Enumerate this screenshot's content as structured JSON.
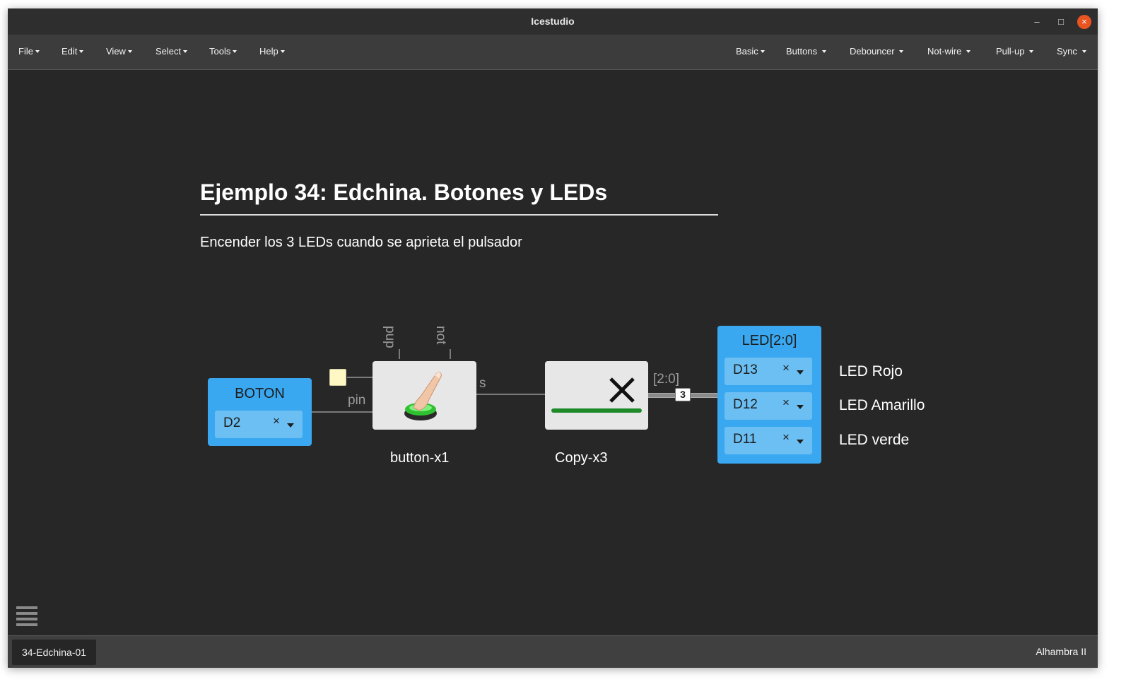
{
  "window": {
    "title": "Icestudio"
  },
  "titlebar_controls": {
    "minimize": "–",
    "maximize": "□",
    "close": "×"
  },
  "menu_left": [
    "File",
    "Edit",
    "View",
    "Select",
    "Tools",
    "Help"
  ],
  "menu_right": [
    "Basic",
    "Buttons",
    "Debouncer",
    "Not-wire",
    "Pull-up",
    "Sync"
  ],
  "canvas": {
    "heading": "Ejemplo 34: Edchina. Botones y LEDs",
    "description": "Encender los 3 LEDs cuando se aprieta el pulsador",
    "input_block": {
      "title": "BOTON",
      "pin": "D2",
      "clear": "×"
    },
    "button_block": {
      "name": "button-x1",
      "port_in": "pin",
      "port_out": "s",
      "param_pup": "pup",
      "param_not": "not"
    },
    "copy_block": {
      "name": "Copy-x3",
      "bus_label": "[2:0]",
      "bus_width": "3"
    },
    "output_block": {
      "title": "LED[2:0]",
      "pins": [
        {
          "value": "D13",
          "clear": "×"
        },
        {
          "value": "D12",
          "clear": "×"
        },
        {
          "value": "D11",
          "clear": "×"
        }
      ]
    },
    "led_labels": [
      "LED Rojo",
      "LED Amarillo",
      "LED verde"
    ]
  },
  "statusbar": {
    "file": "34-Edchina-01",
    "board": "Alhambra II"
  },
  "colors": {
    "io_block": "#39a8f0",
    "pin_select": "#6bbff3",
    "close_button": "#e95420",
    "constant_box": "#fff8c4"
  }
}
